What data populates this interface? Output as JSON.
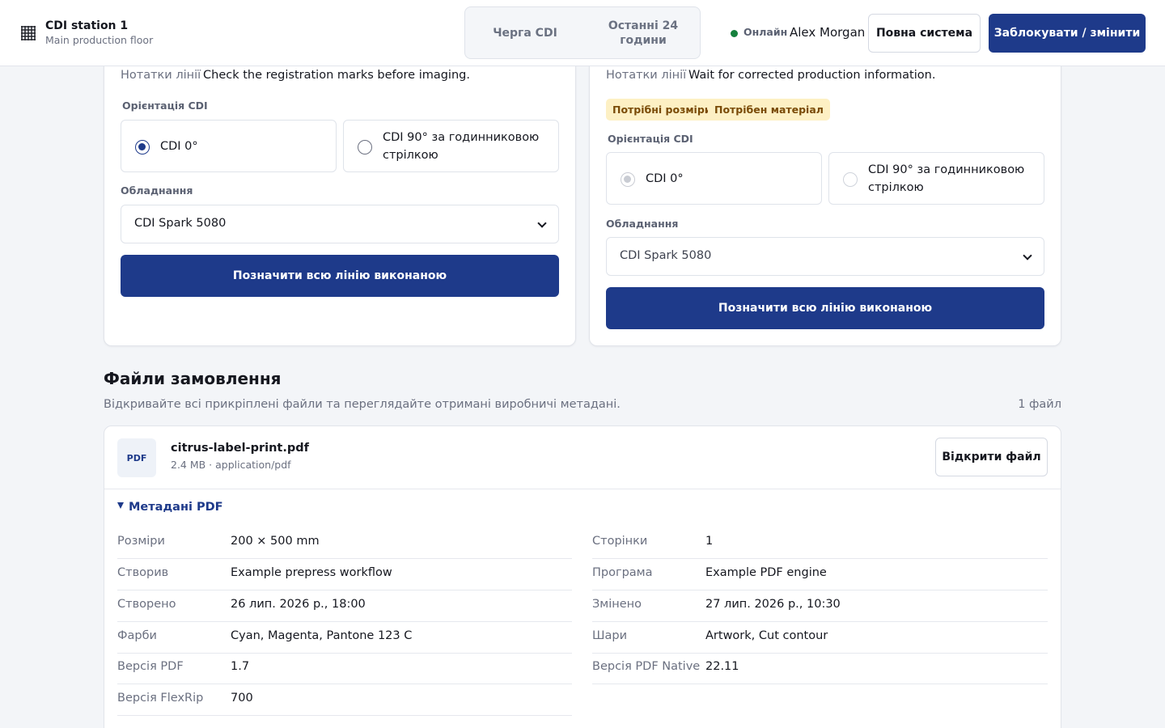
{
  "header": {
    "station_title": "CDI station 1",
    "station_subtitle": "Main production floor",
    "tabs": [
      {
        "label": "Черга CDI"
      },
      {
        "label": "Останні 24 години"
      }
    ],
    "status": "Онлайн",
    "user": "Alex Morgan",
    "full_system_label": "Повна система",
    "lock_label": "Заблокувати / змінити"
  },
  "lines": [
    {
      "notes_label": "Нотатки лінії",
      "notes": "Check the registration marks before imaging.",
      "badges": [],
      "orientation_label": "Орієнтація CDI",
      "orientation_options": [
        "CDI 0°",
        "CDI 90° за годинниковою стрілкою"
      ],
      "orientation_selected": "CDI 0°",
      "equipment_label": "Обладнання",
      "equipment": "CDI Spark 5080",
      "done_label": "Позначити всю лінію виконаною"
    },
    {
      "notes_label": "Нотатки лінії",
      "notes": "Wait for corrected production information.",
      "badges": [
        "Потрібні розміри",
        "Потрібен матеріал"
      ],
      "orientation_label": "Орієнтація CDI",
      "orientation_options": [
        "CDI 0°",
        "CDI 90° за годинниковою стрілкою"
      ],
      "orientation_selected": "CDI 0°",
      "equipment_label": "Обладнання",
      "equipment": "CDI Spark 5080",
      "done_label": "Позначити всю лінію виконаною"
    }
  ],
  "files": {
    "title": "Файли замовлення",
    "subtitle": "Відкривайте всі прикріплені файли та переглядайте отримані виробничі метадані.",
    "count": "1 файл",
    "items": [
      {
        "type_badge": "PDF",
        "name": "citrus-label-print.pdf",
        "meta": "2.4 MB · application/pdf",
        "open_label": "Відкрити файл",
        "metadata_title": "Метадані PDF",
        "metadata_left": [
          {
            "key": "Розміри",
            "value": "200 × 500 mm"
          },
          {
            "key": "Створив",
            "value": "Example prepress workflow"
          },
          {
            "key": "Створено",
            "value": "26 лип. 2026 р., 18:00"
          },
          {
            "key": "Фарби",
            "value": "Cyan, Magenta, Pantone 123 C"
          },
          {
            "key": "Версія PDF",
            "value": "1.7"
          },
          {
            "key": "Версія FlexRip",
            "value": "700"
          }
        ],
        "metadata_right": [
          {
            "key": "Сторінки",
            "value": "1"
          },
          {
            "key": "Програма",
            "value": "Example PDF engine"
          },
          {
            "key": "Змінено",
            "value": "27 лип. 2026 р., 10:30"
          },
          {
            "key": "Шари",
            "value": "Artwork, Cut contour"
          },
          {
            "key": "Версія PDF Native",
            "value": "22.11"
          }
        ]
      }
    ]
  },
  "colors": {
    "primary": "#1e3a8a",
    "online": "#15803d",
    "badge_bg": "#fdf0c4",
    "badge_text": "#7a4b07"
  }
}
